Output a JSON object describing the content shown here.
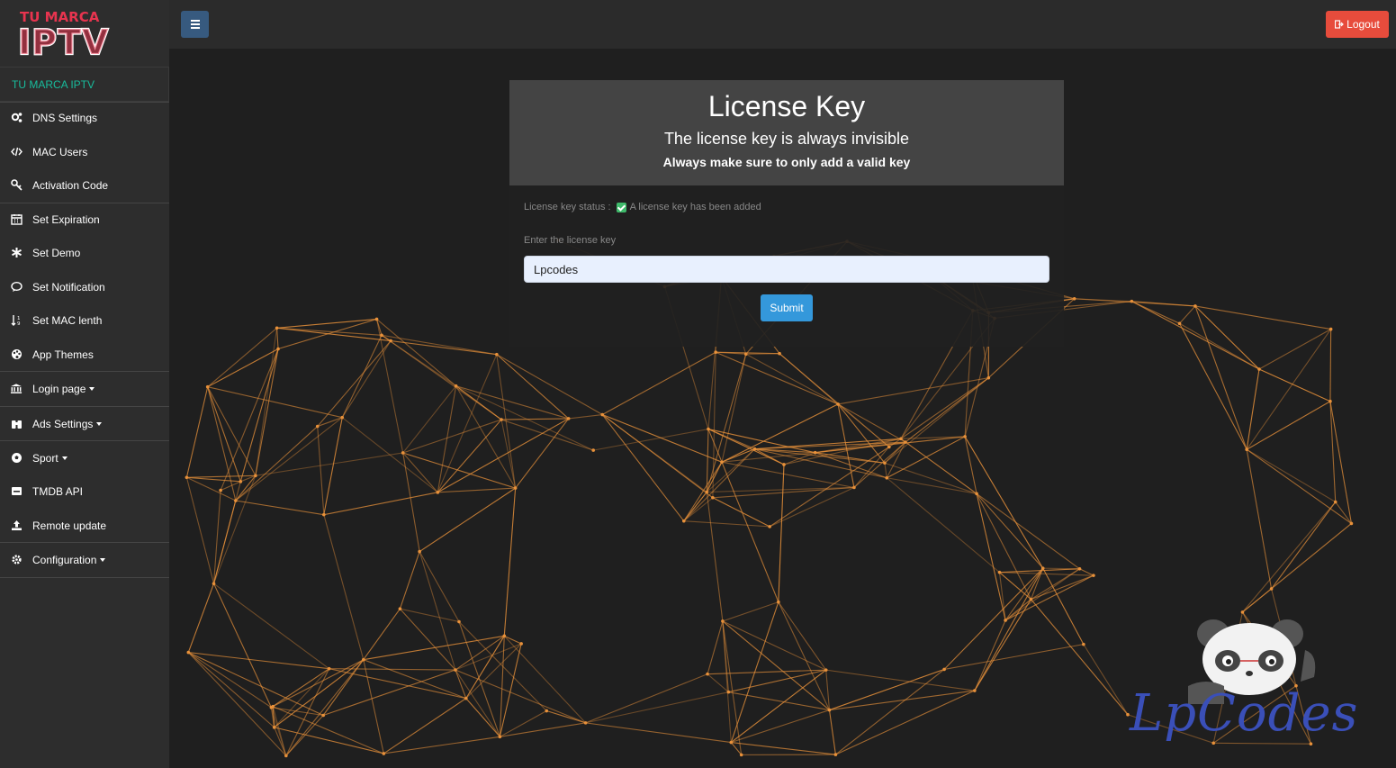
{
  "logo": {
    "line1": "TU MARCA",
    "line2": "IPTV"
  },
  "sidebar": {
    "brand": "TU MARCA IPTV",
    "items": [
      {
        "label": "DNS Settings",
        "icon": "cogs-icon"
      },
      {
        "label": "MAC Users",
        "icon": "code-icon"
      },
      {
        "label": "Activation Code",
        "icon": "key-icon"
      },
      {
        "label": "Set Expiration",
        "icon": "calendar-icon"
      },
      {
        "label": "Set Demo",
        "icon": "asterisk-icon"
      },
      {
        "label": "Set Notification",
        "icon": "comment-icon"
      },
      {
        "label": "Set MAC lenth",
        "icon": "sort-numeric-icon"
      },
      {
        "label": "App Themes",
        "icon": "palette-icon"
      },
      {
        "label": "Login page",
        "icon": "bank-icon"
      },
      {
        "label": "Ads Settings",
        "icon": "binoculars-icon"
      },
      {
        "label": "Sport",
        "icon": "soccer-ball-icon"
      },
      {
        "label": "TMDB API",
        "icon": "window-icon"
      },
      {
        "label": "Remote update",
        "icon": "upload-icon"
      },
      {
        "label": "Configuration",
        "icon": "gear-icon"
      }
    ]
  },
  "topbar": {
    "logout_label": "Logout"
  },
  "card": {
    "title": "License Key",
    "subtitle": "The license key is always invisible",
    "note": "Always make sure to only add a valid key",
    "status_label": "License key status :",
    "status_text": "A license key has been added",
    "input_label": "Enter the license key",
    "input_value": "Lpcodes",
    "submit_label": "Submit"
  },
  "watermark": {
    "text": "LpCodes"
  },
  "colors": {
    "accent_green": "#18bc9c",
    "logout_red": "#e74c3c",
    "submit_blue": "#3498db",
    "toggle_blue": "#375a7f",
    "network_orange": "#e8913a"
  }
}
